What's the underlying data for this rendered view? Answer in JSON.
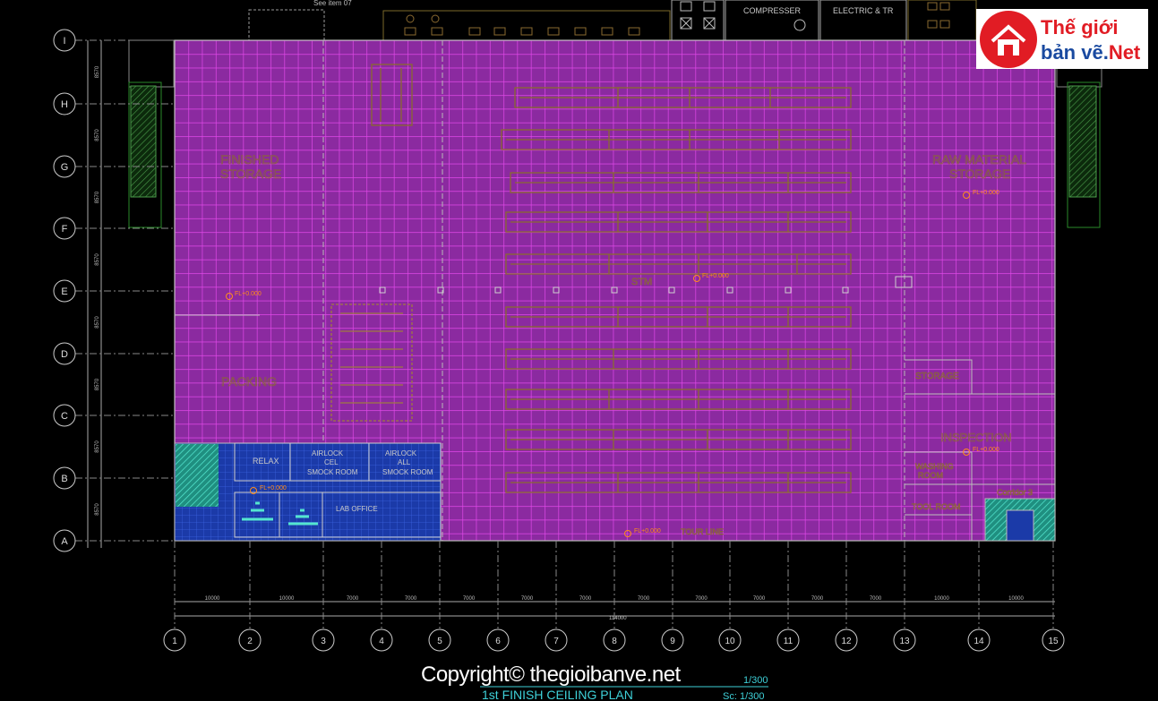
{
  "header": {
    "see_item": "See item 07",
    "compressor": "COMPRESSER",
    "electric": "ELECTRIC & TR"
  },
  "rooms": {
    "finished_storage_1": "FINISHED",
    "finished_storage_2": "STORAGE",
    "raw_material_1": "RAW MATERIAL",
    "raw_material_2": "STORAGE",
    "packing": "PACKING",
    "stm": "STM",
    "storage": "STORAGE",
    "inspection": "INSPECTION",
    "washing_1": "WASHING",
    "washing_2": "ROOM",
    "tool_room": "TOOL ROOM",
    "corridor": "Corridor 3",
    "relax": "RELAX",
    "office": "LAB OFFICE",
    "airlock1_1": "AIRLOCK",
    "airlock1_2": "CEL",
    "smock1": "SMOCK ROOM",
    "airlock2_1": "AIRLOCK",
    "airlock2_2": "ALL",
    "smock2": "SMOCK ROOM",
    "tour_line": "TOUR LINE"
  },
  "levels": {
    "l1": "FL+0.000",
    "l2": "FL+0.000",
    "l3": "FL+0.000",
    "l4": "FL+0.000",
    "l5": "FL+0.000",
    "l6": "FL+0.000"
  },
  "grid_rows": [
    "I",
    "H",
    "G",
    "F",
    "E",
    "D",
    "C",
    "B",
    "A"
  ],
  "grid_cols": [
    "1",
    "2",
    "3",
    "4",
    "5",
    "6",
    "7",
    "8",
    "9",
    "10",
    "11",
    "12",
    "13",
    "14",
    "15"
  ],
  "dimensions": [
    "10000",
    "10000",
    "7000",
    "7000",
    "7000",
    "7000",
    "7000",
    "7000",
    "7000",
    "7000",
    "7000",
    "7000",
    "10000",
    "10000",
    "10000"
  ],
  "total_dimension": "114000",
  "row_dims": [
    "8570",
    "8570",
    "8570",
    "8570",
    "8570",
    "8570",
    "8570",
    "8570"
  ],
  "title": {
    "main": "1st FINISH CEILING PLAN",
    "scale1": "1/300",
    "scale2": "Sc: 1/300"
  },
  "watermark": "Copyright© thegioibanve.net",
  "logo": {
    "line1": "Thế giới",
    "line2": "bản vẽ.",
    "line2_suffix": "Net"
  },
  "colors": {
    "background": "#000000",
    "ceiling_grid": "#c236c8",
    "ceiling_fill": "#8a1f9a",
    "blue_zone": "#1a3fb0",
    "teal_zone": "#2fc7b0",
    "equipment": "#8a6a30",
    "annotation": "#ff8c1a"
  }
}
